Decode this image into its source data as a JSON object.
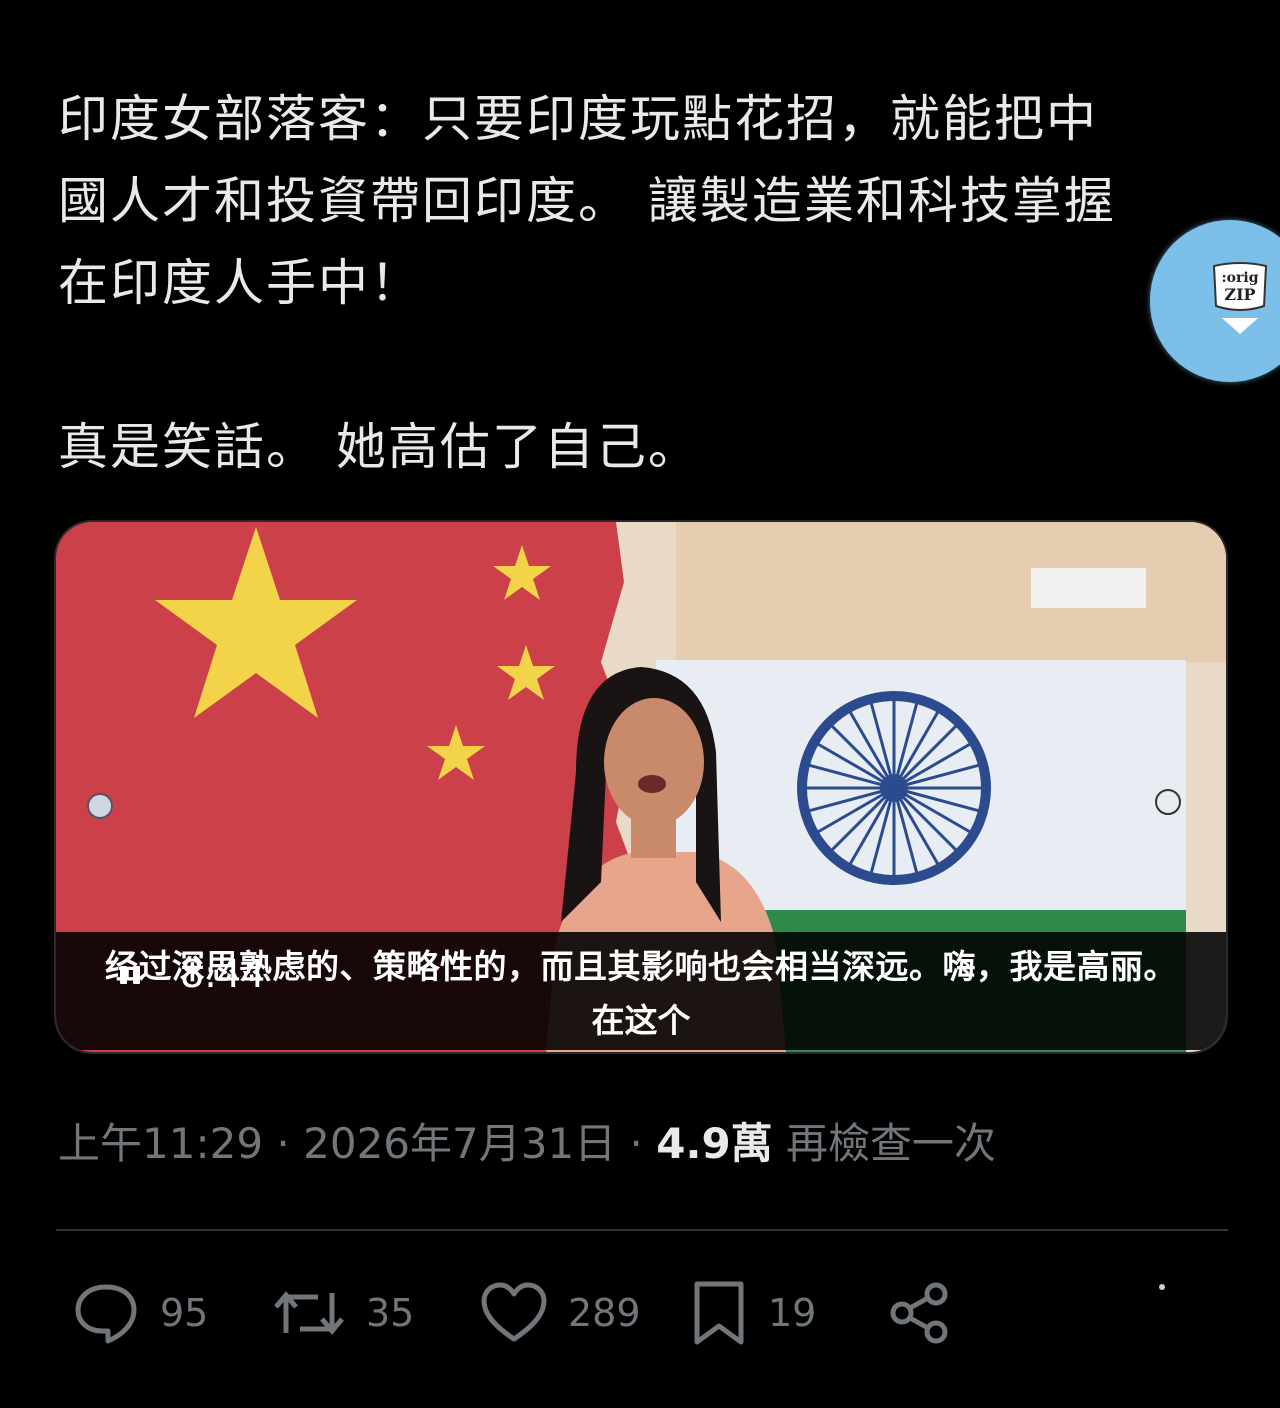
{
  "tweet": {
    "lines": [
      "印度女部落客：只要印度玩點花招，就能把中",
      "國人才和投資帶回印度。 讓製造業和科技掌握",
      "在印度人手中！",
      "真是笑話。 她高估了自己。"
    ]
  },
  "orig_zip": {
    "label_top": ":orig",
    "label_bottom": "ZIP",
    "icon": "download-arrow-icon"
  },
  "video": {
    "subtitle_line1": "经过深思熟虑的、策略性的，而且其影响也会相当深远。嗨，我是高丽。",
    "subtitle_line2": "在这个",
    "time": "8:44",
    "control_icon": "pause-icon"
  },
  "meta": {
    "time": "上午11:29",
    "separator": "·",
    "date": "2026年7月31日",
    "views": "4.9萬",
    "views_label": "再檢查一次"
  },
  "actions": {
    "reply": {
      "icon": "reply-icon",
      "count": "95"
    },
    "retweet": {
      "icon": "retweet-icon",
      "count": "35"
    },
    "like": {
      "icon": "heart-icon",
      "count": "289"
    },
    "bookmark": {
      "icon": "bookmark-icon",
      "count": "19"
    },
    "share": {
      "icon": "share-icon"
    }
  },
  "colors": {
    "background": "#000000",
    "text": "#e7e9ea",
    "secondary": "#71767b",
    "orig_zip_bg": "#7cc0ea"
  }
}
